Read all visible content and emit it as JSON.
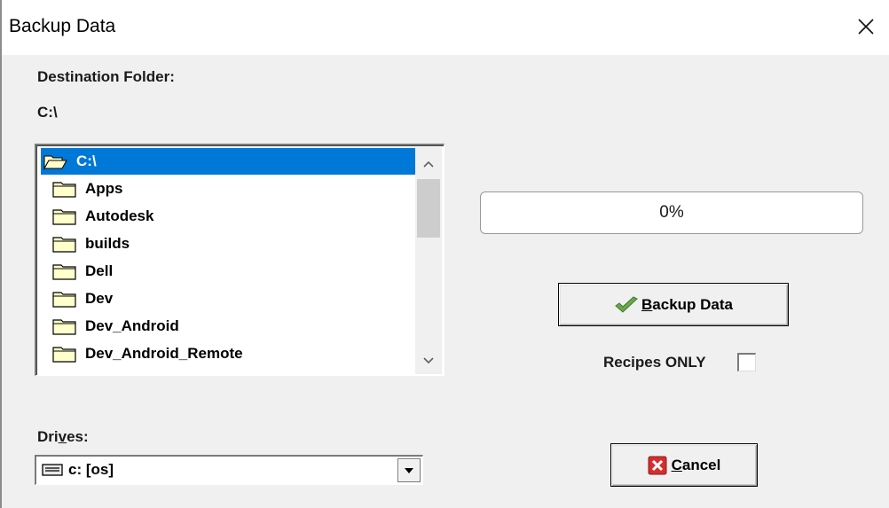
{
  "window": {
    "title": "Backup Data"
  },
  "destination": {
    "label": "Destination Folder:",
    "path": "C:\\"
  },
  "folder_list": {
    "items": [
      {
        "label": "C:\\",
        "selected": true,
        "icon": "open-folder-icon"
      },
      {
        "label": "Apps",
        "icon": "folder-icon"
      },
      {
        "label": "Autodesk",
        "icon": "folder-icon"
      },
      {
        "label": "builds",
        "icon": "folder-icon"
      },
      {
        "label": "Dell",
        "icon": "folder-icon"
      },
      {
        "label": "Dev",
        "icon": "folder-icon"
      },
      {
        "label": "Dev_Android",
        "icon": "folder-icon"
      },
      {
        "label": "Dev_Android_Remote",
        "icon": "folder-icon"
      }
    ]
  },
  "progress": {
    "text": "0%",
    "value": 0
  },
  "backup_button": {
    "label_first": "B",
    "label_rest": "ackup Data",
    "icon": "checkmark-icon"
  },
  "recipes_only": {
    "label": "Recipes ONLY",
    "checked": false
  },
  "drives": {
    "label_pre": "Dri",
    "label_accel": "v",
    "label_post": "es:",
    "selected": "c: [os]",
    "icon": "drive-icon"
  },
  "cancel_button": {
    "label_first": "C",
    "label_rest": "ancel",
    "icon": "red-x-icon"
  },
  "colors": {
    "selection": "#0078d7",
    "background": "#f0f0f0"
  }
}
